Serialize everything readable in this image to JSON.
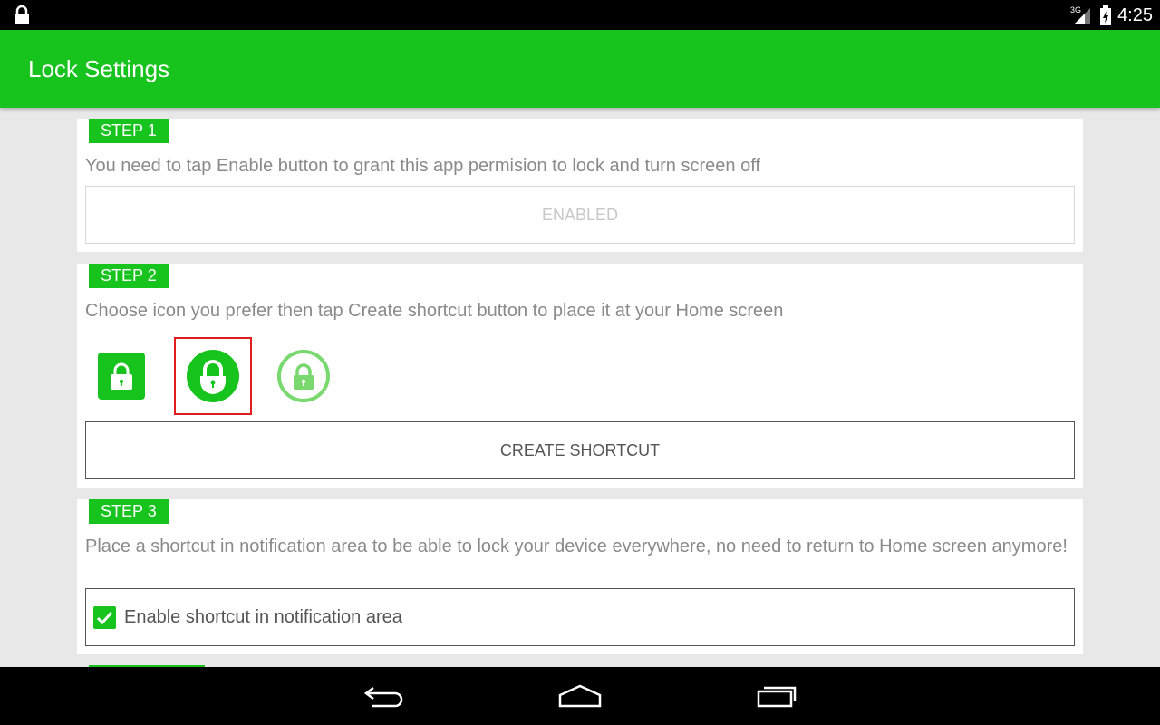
{
  "status_bar": {
    "time": "4:25",
    "network": "3G"
  },
  "app_bar": {
    "title": "Lock Settings"
  },
  "steps": [
    {
      "badge": "STEP 1",
      "description": "You need to tap Enable button to grant this app permision to lock and turn screen off",
      "button_label": "ENABLED"
    },
    {
      "badge": "STEP 2",
      "description": "Choose icon you prefer then tap Create shortcut button to place it at your Home screen",
      "icons": [
        "lock-square-icon",
        "lock-circle-filled-icon",
        "lock-circle-outline-icon"
      ],
      "selected_icon_index": 1,
      "button_label": "CREATE SHORTCUT"
    },
    {
      "badge": "STEP 3",
      "description": "Place a shortcut in notification area to be able to lock your device everywhere, no need to return to Home screen anymore!",
      "checkbox_label": "Enable shortcut in notification area",
      "checkbox_checked": true
    }
  ],
  "colors": {
    "accent": "#17c31d",
    "selection": "#e01e1e"
  },
  "nav": {
    "icons": [
      "back-icon",
      "home-icon",
      "recents-icon"
    ]
  }
}
